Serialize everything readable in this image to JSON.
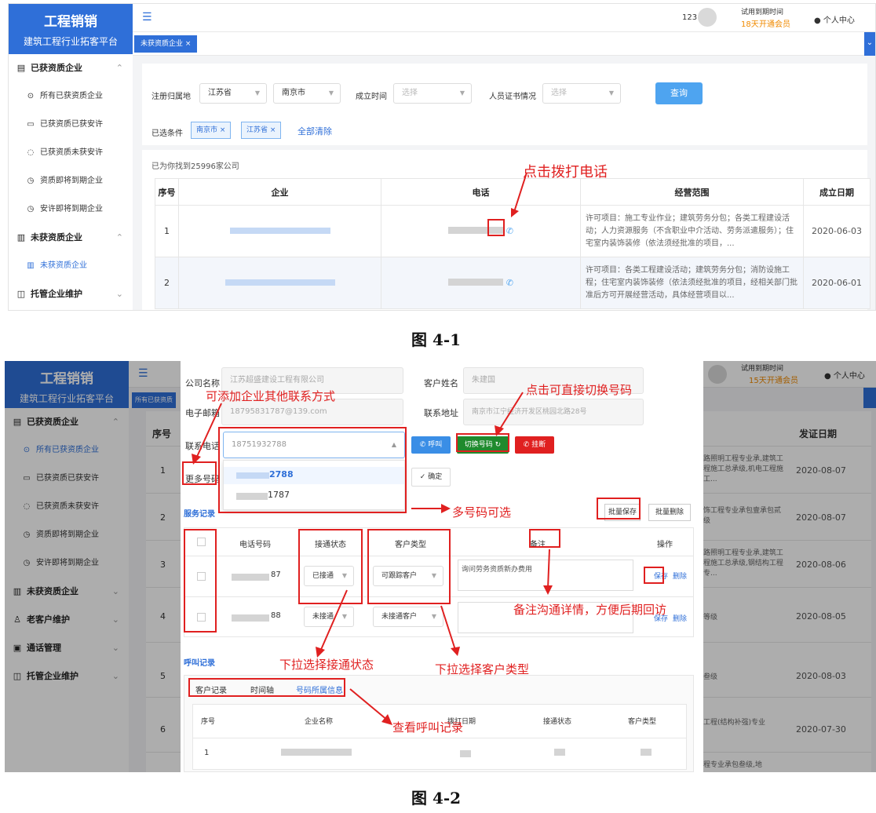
{
  "app": {
    "title": "工程销销",
    "subtitle": "建筑工程行业拓客平台"
  },
  "header": {
    "user_id": "123",
    "trial_label": "试用到期时间",
    "trial_days": "18天",
    "upgrade": "开通会员",
    "personal": "个人中心"
  },
  "sidebar": {
    "group1": "已获资质企业",
    "items": [
      "所有已获资质企业",
      "已获资质已获安许",
      "已获资质未获安许",
      "资质即将到期企业",
      "安许即将到期企业"
    ],
    "group2": "未获资质企业",
    "group2_item": "未获资质企业",
    "group3": "托管企业维护",
    "group4": "老客户维护",
    "group5": "通话管理"
  },
  "shot1": {
    "tab": "未获资质企业",
    "filters": {
      "region_label": "注册归属地",
      "province": "江苏省",
      "city": "南京市",
      "founded_label": "成立时间",
      "founded_ph": "选择",
      "cert_label": "人员证书情况",
      "cert_ph": "选择",
      "query": "查询"
    },
    "selected": {
      "label": "已选条件",
      "chips": [
        "南京市",
        "江苏省"
      ],
      "clear": "全部清除"
    },
    "found_prefix": "已为你找到",
    "found_count": "25996",
    "found_suffix": "家公司",
    "columns": [
      "序号",
      "企业",
      "电话",
      "经营范围",
      "成立日期"
    ],
    "rows": [
      {
        "no": "1",
        "scope": "许可项目：施工专业作业；建筑劳务分包；各类工程建设活动；人力资源服务（不含职业中介活动、劳务派遣服务）；住宅室内装饰装修（依法须经批准的项目，...",
        "date": "2020-06-03"
      },
      {
        "no": "2",
        "scope": "许可项目：各类工程建设活动；建筑劳务分包；消防设施工程；住宅室内装饰装修（依法须经批准的项目，经相关部门批准后方可开展经营活动，具体经营项目以...",
        "date": "2020-06-01"
      }
    ],
    "annotation": "点击拨打电话",
    "caption": "图 4-1"
  },
  "shot2": {
    "trial_days": "15天",
    "tab_partial": "所有已获资质",
    "bg_columns": {
      "no": "序号",
      "date": "发证日期"
    },
    "bg_rows": [
      {
        "no": "1",
        "text": "路照明工程专业承,建筑工程施工总承级,机电工程施工...",
        "date": "2020-08-07"
      },
      {
        "no": "2",
        "text": "饰工程专业承包壹承包贰级",
        "date": "2020-08-07"
      },
      {
        "no": "3",
        "text": "路照明工程专业承,建筑工程施工总承级,钢结构工程专...",
        "date": "2020-08-06"
      },
      {
        "no": "4",
        "text": "等级",
        "date": "2020-08-05"
      },
      {
        "no": "5",
        "text": "叁级",
        "date": "2020-08-03"
      },
      {
        "no": "6",
        "text": "工程(结构补强)专业",
        "date": "2020-07-30"
      },
      {
        "no": "",
        "text": "程专业承包叁级,地",
        "date": ""
      }
    ],
    "modal": {
      "company_label": "公司名称",
      "company": "江苏超盛建设工程有限公司",
      "contact_label": "客户姓名",
      "contact": "朱建国",
      "email_label": "电子邮箱",
      "email": "18795831787@139.com",
      "address_label": "联系地址",
      "address": "南京市江宁经济开发区桃园北路28号",
      "phone_label": "联系电话",
      "phone": "18751932788",
      "call": "呼叫",
      "switch": "切换号码",
      "hangup": "挂断",
      "more_label": "更多号码",
      "confirm": "确定",
      "dropdown": [
        "2788",
        "1787"
      ],
      "service_title": "服务记录",
      "batch_save": "批量保存",
      "batch_delete": "批量删除",
      "svc_columns": [
        "电话号码",
        "接通状态",
        "客户类型",
        "备注",
        "操作"
      ],
      "svc_rows": [
        {
          "phone_tail": "87",
          "status": "已接通",
          "type": "可跟踪客户",
          "note": "询问劳务资质新办费用",
          "save": "保存",
          "delete": "删除"
        },
        {
          "phone_tail": "88",
          "status": "未接通",
          "type": "未接通客户",
          "note": "",
          "save": "保存",
          "delete": "删除"
        }
      ],
      "call_title": "呼叫记录",
      "call_tabs": [
        "客户记录",
        "时间轴",
        "号码所属信息"
      ],
      "call_columns": [
        "序号",
        "企业名称",
        "拨打日期",
        "接通状态",
        "客户类型"
      ],
      "call_rows": [
        {
          "no": "1"
        }
      ]
    },
    "annotations": {
      "a1": "可添加企业其他联系方式",
      "a2": "点击可直接切换号码",
      "a3": "多号码可选",
      "a4": "备注沟通详情，方便后期回访",
      "a5": "下拉选择接通状态",
      "a6": "下拉选择客户类型",
      "a7": "查看呼叫记录"
    },
    "caption": "图 4-2"
  }
}
